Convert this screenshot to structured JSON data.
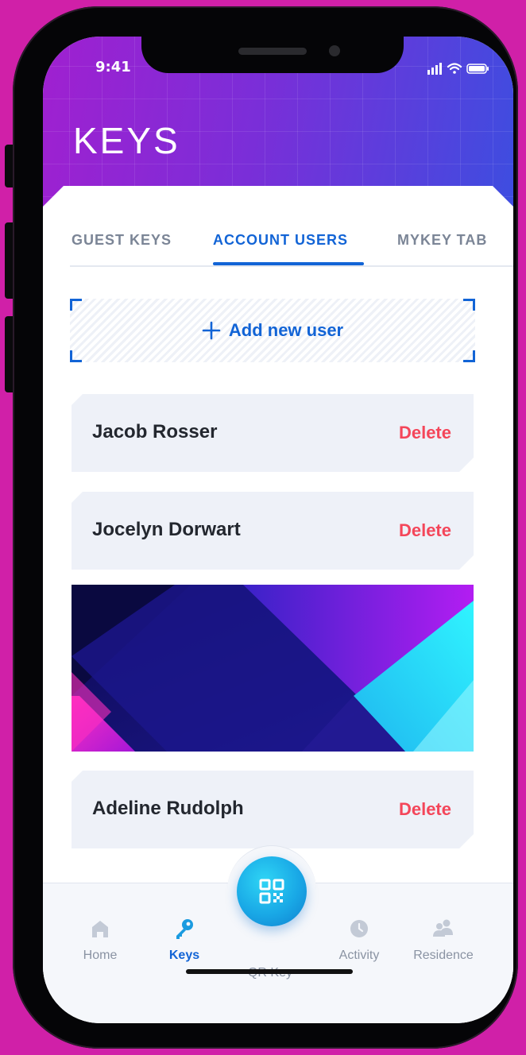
{
  "status_bar": {
    "time": "9:41"
  },
  "header": {
    "title": "KEYS"
  },
  "tabs": [
    {
      "label": "GUEST KEYS",
      "active": false
    },
    {
      "label": "ACCOUNT USERS",
      "active": true
    },
    {
      "label": "MYKEY TAB",
      "active": false
    }
  ],
  "add_user": {
    "icon": "plus-icon",
    "label": "Add new user"
  },
  "users": [
    {
      "name": "Jacob Rosser",
      "action": "Delete"
    },
    {
      "name": "Jocelyn Dorwart",
      "action": "Delete"
    },
    {
      "name": "Adeline Rudolph",
      "action": "Delete"
    }
  ],
  "bottom_nav": {
    "items": [
      {
        "label": "Home",
        "icon": "home-icon",
        "active": false
      },
      {
        "label": "Keys",
        "icon": "key-icon",
        "active": true
      },
      {
        "label": "QR Key",
        "icon": "qr-code-icon",
        "active": false
      },
      {
        "label": "Activity",
        "icon": "clock-icon",
        "active": false
      },
      {
        "label": "Residence",
        "icon": "people-icon",
        "active": false
      }
    ]
  },
  "colors": {
    "accent": "#1264d6",
    "delete": "#f4465a",
    "header_start": "#a020d0",
    "header_end": "#3c4ee0",
    "background": "#d020a8"
  }
}
